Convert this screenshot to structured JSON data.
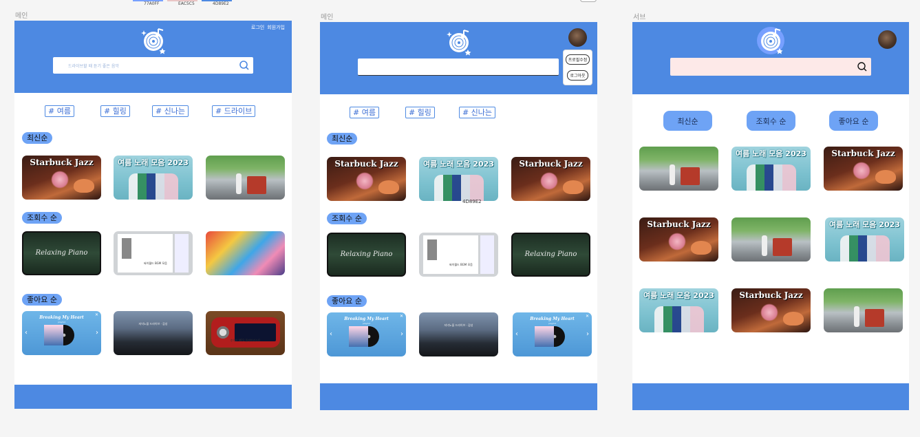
{
  "swatches": [
    {
      "label": "77A0FF",
      "color": "#77a0ff"
    },
    {
      "label": "EAC5C5",
      "color": "#eac5c5"
    },
    {
      "label": "4D89E2",
      "color": "#4d89e2"
    }
  ],
  "colors": {
    "primary": "#4d89e2",
    "accent": "#77a0ff",
    "pink": "#eac5c5",
    "pill": "#6ea3f5"
  },
  "frames": {
    "main1": {
      "label": "메인",
      "auth": {
        "login": "로그인",
        "signup": "회원가입"
      },
      "search_placeholder": "드라이브할 때 듣기 좋은 음악",
      "tags": [
        "# 여름",
        "# 힐링",
        "# 신나는",
        "# 드라이브"
      ],
      "sections": [
        "최신순",
        "조회수 순",
        "좋아요 순"
      ]
    },
    "main2": {
      "label": "메인",
      "menu": {
        "edit_profile": "프로필수정",
        "logout": "로그아웃"
      },
      "tags": [
        "# 여름",
        "# 힐링",
        "# 신나는"
      ],
      "sections": [
        "최신순",
        "조회수 순",
        "좋아요 순"
      ],
      "tooltip": "4D89E2"
    },
    "sub": {
      "label": "서브",
      "sort_buttons": [
        "최신순",
        "조회수 순",
        "좋아요 순"
      ]
    }
  },
  "thumbs": {
    "jazz": "Starbuck Jazz",
    "summer": "여름 노래 모음 2023",
    "piano": "Relaxing Piano",
    "doc_caption": "싸이월드 BGM 모음",
    "break_title": "Breaking My Heart",
    "break_sub": "playlist",
    "night_caption": "저녁노을 드라이브 · 감성",
    "radio_caption": "추억의 MP3 플레이리스트"
  },
  "icons": [
    "music-logo-icon",
    "search-icon",
    "avatar",
    "chevron-left-icon",
    "chevron-right-icon",
    "close-icon"
  ]
}
